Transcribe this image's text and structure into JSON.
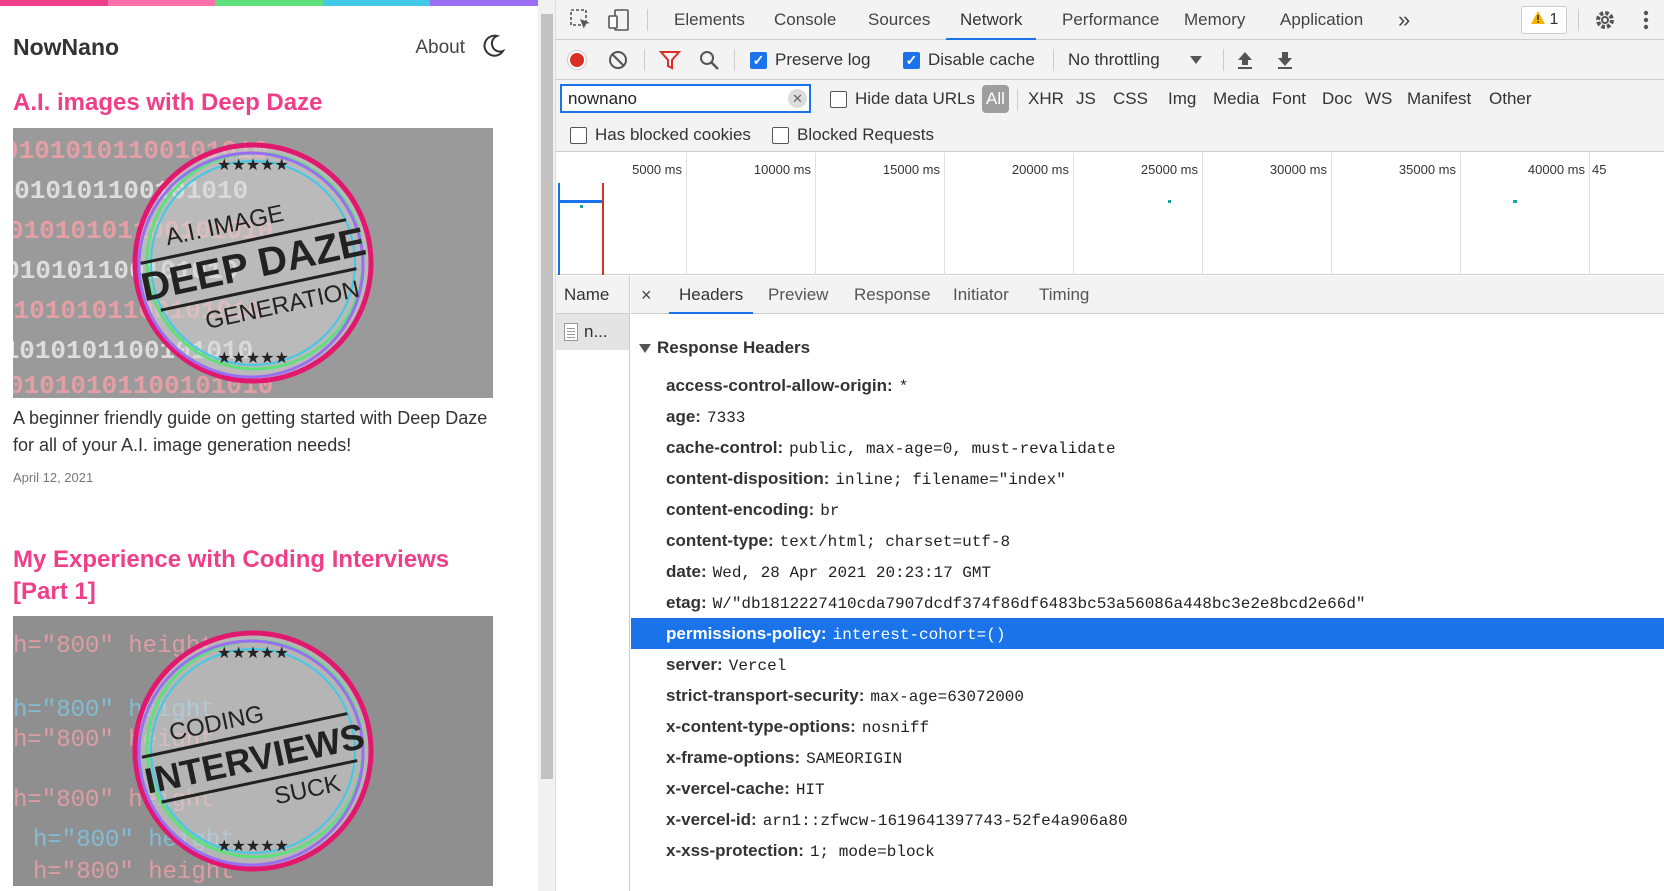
{
  "site": {
    "rainbow": [
      "#f03f8a",
      "#ff6fa8",
      "#5ee07a",
      "#41c9e6",
      "#9a6ef2"
    ],
    "logo": "NowNano",
    "nav_about": "About",
    "posts": [
      {
        "title": "A.I. images with Deep Daze",
        "badge_lines": [
          "A.I. IMAGE",
          "DEEP DAZE",
          "GENERATION"
        ],
        "bg_text": "01010101100101010",
        "description": "A beginner friendly guide on getting started with Deep Daze for all of your A.I. image generation needs!",
        "date": "April 12, 2021"
      },
      {
        "title": "My Experience with Coding Interviews [Part 1]",
        "badge_lines": [
          "CODING",
          "INTERVIEWS",
          "SUCK"
        ],
        "bg_text": "h=\"800\" height"
      }
    ]
  },
  "devtools": {
    "tabs": [
      "Elements",
      "Console",
      "Sources",
      "Network",
      "Performance",
      "Memory",
      "Application"
    ],
    "active_tab": "Network",
    "more": "»",
    "warnings": "1",
    "toolbar": {
      "preserve_log": "Preserve log",
      "disable_cache": "Disable cache",
      "throttling": "No throttling"
    },
    "filter": {
      "value": "nownano",
      "hide_data_urls": "Hide data URLs",
      "types": [
        "All",
        "XHR",
        "JS",
        "CSS",
        "Img",
        "Media",
        "Font",
        "Doc",
        "WS",
        "Manifest",
        "Other"
      ],
      "has_blocked_cookies": "Has blocked cookies",
      "blocked_requests": "Blocked Requests"
    },
    "timeline_labels": [
      "5000 ms",
      "10000 ms",
      "15000 ms",
      "20000 ms",
      "25000 ms",
      "30000 ms",
      "35000 ms",
      "40000 ms",
      "45"
    ],
    "request_list": {
      "header": "Name",
      "rows": [
        "n..."
      ]
    },
    "detail_tabs": [
      "Headers",
      "Preview",
      "Response",
      "Initiator",
      "Timing"
    ],
    "close": "×",
    "section": "Response Headers",
    "headers": [
      {
        "k": "access-control-allow-origin:",
        "v": "*"
      },
      {
        "k": "age:",
        "v": "7333"
      },
      {
        "k": "cache-control:",
        "v": "public, max-age=0, must-revalidate"
      },
      {
        "k": "content-disposition:",
        "v": "inline; filename=\"index\""
      },
      {
        "k": "content-encoding:",
        "v": "br"
      },
      {
        "k": "content-type:",
        "v": "text/html; charset=utf-8"
      },
      {
        "k": "date:",
        "v": "Wed, 28 Apr 2021 20:23:17 GMT"
      },
      {
        "k": "etag:",
        "v": "W/\"db1812227410cda7907dcdf374f86df6483bc53a56086a448bc3e2e8bcd2e66d\""
      },
      {
        "k": "permissions-policy:",
        "v": "interest-cohort=()"
      },
      {
        "k": "server:",
        "v": "Vercel"
      },
      {
        "k": "strict-transport-security:",
        "v": "max-age=63072000"
      },
      {
        "k": "x-content-type-options:",
        "v": "nosniff"
      },
      {
        "k": "x-frame-options:",
        "v": "SAMEORIGIN"
      },
      {
        "k": "x-vercel-cache:",
        "v": "HIT"
      },
      {
        "k": "x-vercel-id:",
        "v": "arn1::zfwcw-1619641397743-52fe4a906a80"
      },
      {
        "k": "x-xss-protection:",
        "v": "1; mode=block"
      }
    ],
    "selected_header": "permissions-policy:"
  }
}
